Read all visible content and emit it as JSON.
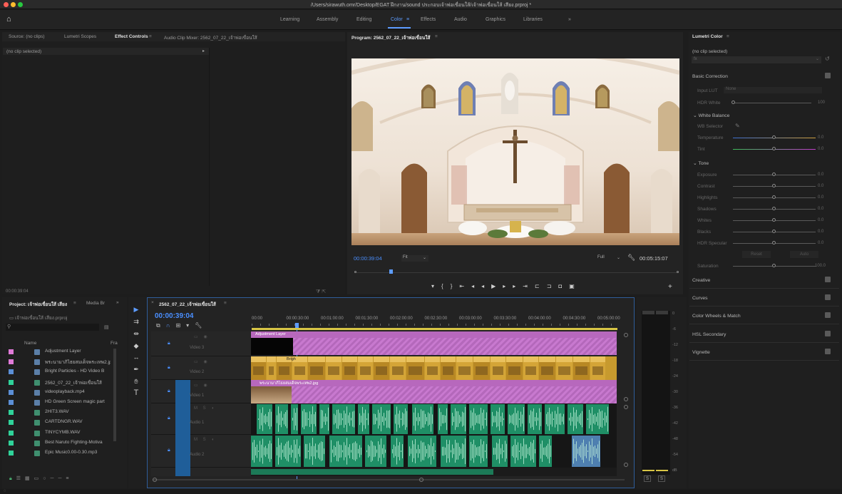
{
  "window": {
    "title": "/Users/sirawuth.omr/Desktop/EGAT ฝึกงาน/sound ประกอบเจ้าพ่อเขื่อนใส้/เจ้าพ่อเขื่อนใส้ เสียง.prproj *"
  },
  "workspaces": {
    "items": [
      {
        "label": "Learning"
      },
      {
        "label": "Assembly"
      },
      {
        "label": "Editing"
      },
      {
        "label": "Color"
      },
      {
        "label": "Effects"
      },
      {
        "label": "Audio"
      },
      {
        "label": "Graphics"
      },
      {
        "label": "Libraries"
      }
    ],
    "active": "Color",
    "more": "»"
  },
  "source_panel": {
    "tabs": [
      {
        "label": "Source: (no clips)"
      },
      {
        "label": "Lumetri Scopes"
      },
      {
        "label": "Effect Controls"
      },
      {
        "label": "Audio Clip Mixer: 2562_07_22_เจ้าพ่อเขื่อนใส้"
      }
    ],
    "no_clip": "(no clip selected)",
    "timecode": "00:00:39:04"
  },
  "program": {
    "title": "Program: 2562_07_22_เจ้าพ่อเขื่อนใส้",
    "timecode": "00:00:39:04",
    "fit": "Fit",
    "quality": "Full",
    "duration": "00:05:15:07"
  },
  "lumetri": {
    "title": "Lumetri Color",
    "no_clip": "(no clip selected)",
    "fx_label": "fx",
    "basic_correction": "Basic Correction",
    "input_lut_label": "Input LUT",
    "input_lut_value": "None",
    "hdr_white_label": "HDR White",
    "hdr_white_value": "100",
    "white_balance": "White Balance",
    "wb_selector": "WB Selector",
    "temperature": {
      "label": "Temperature",
      "value": "0.0"
    },
    "tint": {
      "label": "Tint",
      "value": "0.0"
    },
    "tone": "Tone",
    "tone_items": [
      {
        "label": "Exposure",
        "value": "0.0"
      },
      {
        "label": "Contrast",
        "value": "0.0"
      },
      {
        "label": "Highlights",
        "value": "0.0"
      },
      {
        "label": "Shadows",
        "value": "0.0"
      },
      {
        "label": "Whites",
        "value": "0.0"
      },
      {
        "label": "Blacks",
        "value": "0.0"
      },
      {
        "label": "HDR Specular",
        "value": "0.0"
      }
    ],
    "reset": "Reset",
    "auto": "Auto",
    "saturation": {
      "label": "Saturation",
      "value": "100.0"
    },
    "sections": [
      {
        "label": "Creative"
      },
      {
        "label": "Curves"
      },
      {
        "label": "Color Wheels & Match"
      },
      {
        "label": "HSL Secondary"
      },
      {
        "label": "Vignette"
      }
    ]
  },
  "project": {
    "tab": "Project: เจ้าพ่อเขื่อนใส้ เสียง",
    "tab2": "Media Br",
    "more": "»",
    "file": "เจ้าพ่อเขื่อนใส้ เสียง.prproj",
    "col_name": "Name",
    "col_fr": "Fra",
    "items": [
      {
        "label": "Adjustment Layer",
        "color": "#e07ad8"
      },
      {
        "label": "พระนามาภิไธยสมเด็จพระเทพ2.jp",
        "color": "#e07ad8"
      },
      {
        "label": "Bright Particles - HD Video B",
        "color": "#5b8fd6"
      },
      {
        "label": "2562_07_22_เจ้าพ่อเขื่อนใส้",
        "color": "#2fd39a"
      },
      {
        "label": "videoplayback.mp4",
        "color": "#5b8fd6"
      },
      {
        "label": "HD Green Screen magic part",
        "color": "#5b8fd6"
      },
      {
        "label": "2HIT3.WAV",
        "color": "#2fd39a"
      },
      {
        "label": "CARTDNGR.WAV",
        "color": "#2fd39a"
      },
      {
        "label": "TINYCYMB.WAV",
        "color": "#2fd39a"
      },
      {
        "label": "Best Naruto Fighting-Motiva",
        "color": "#2fd39a"
      },
      {
        "label": "Epic Music0.00-0.30.mp3",
        "color": "#2fd39a"
      }
    ]
  },
  "timeline": {
    "tab": "2562_07_22_เจ้าพ่อเขื่อนใส้",
    "timecode": "00:00:39:04",
    "ruler": [
      "00:00",
      "00:00:30:00",
      "00:01:00:00",
      "00:01:30:00",
      "00:02:00:00",
      "00:02:30:00",
      "00:03:00:00",
      "00:03:30:00",
      "00:04:00:00",
      "00:04:30:00",
      "00:05:00:00"
    ],
    "tracks": [
      {
        "id": "V3",
        "label": "Video 3"
      },
      {
        "id": "V2",
        "label": "Video 2"
      },
      {
        "id": "V1",
        "label": "Video 1"
      },
      {
        "id": "A1",
        "label": "Audio 1"
      },
      {
        "id": "A2",
        "label": "Audio 2"
      }
    ],
    "adjustment_clip": "Adjustment Layer",
    "image_clip": "พระนามาภิไธยสมเด็จพระเทพ2.jpg",
    "bright_clip": "Brigh"
  },
  "meter": {
    "scale": [
      "0",
      "-6",
      "-12",
      "-18",
      "-24",
      "-30",
      "-36",
      "-42",
      "-48",
      "-54",
      "dB"
    ],
    "solo": [
      "S",
      "S"
    ]
  },
  "colors": {
    "accent": "#5d9cff",
    "pink": "#c879cf",
    "audio": "#1f8f66",
    "video": "#d1a23a"
  }
}
